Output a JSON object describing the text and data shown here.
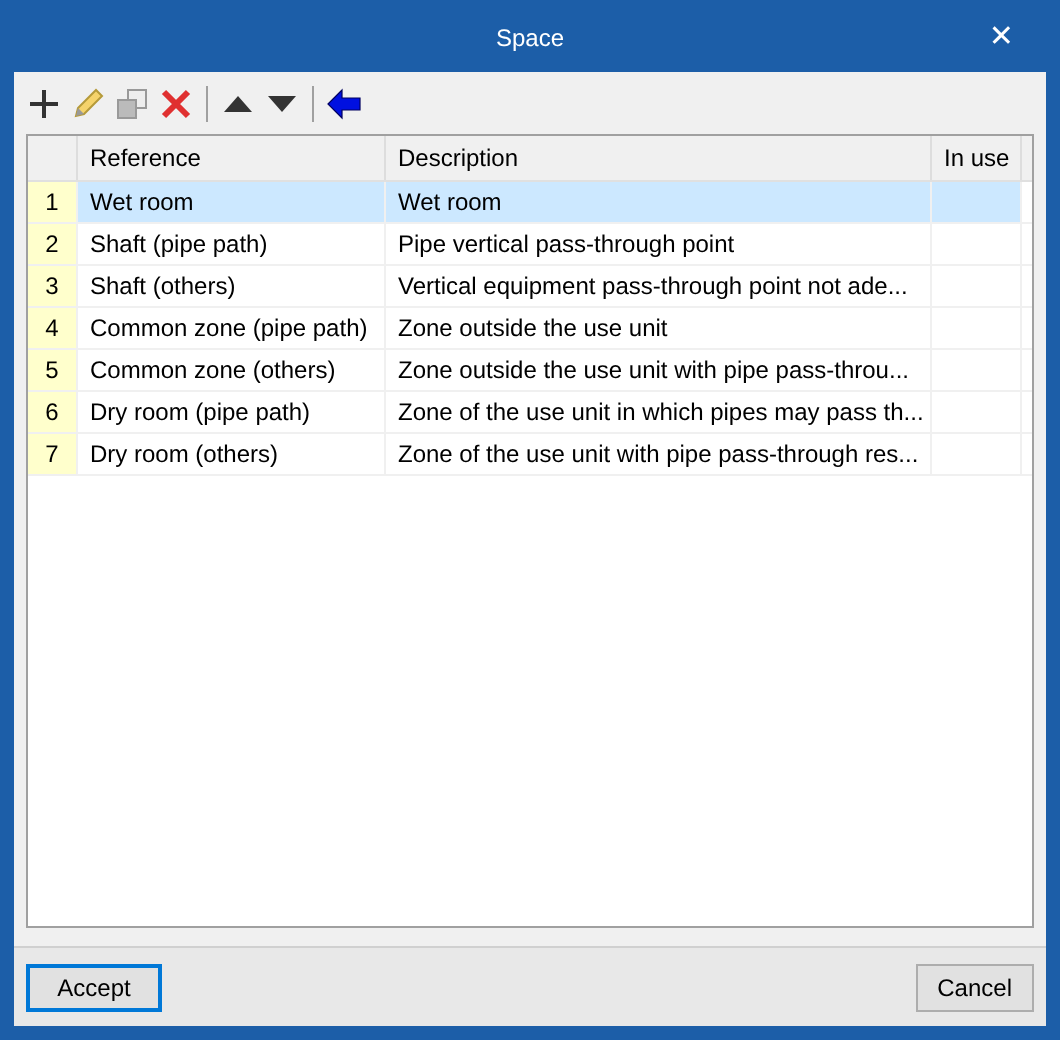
{
  "window": {
    "title": "Space",
    "close": "✕"
  },
  "toolbar": [
    {
      "kind": "add"
    },
    {
      "kind": "edit"
    },
    {
      "kind": "copy"
    },
    {
      "kind": "delete"
    },
    {
      "kind": "sep"
    },
    {
      "kind": "up"
    },
    {
      "kind": "down"
    },
    {
      "kind": "sep"
    },
    {
      "kind": "back"
    }
  ],
  "table": {
    "columns": [
      "Reference",
      "Description",
      "In use"
    ],
    "rows": [
      {
        "number": "1",
        "reference": "Wet room",
        "description": "Wet room",
        "selected": true
      },
      {
        "number": "2",
        "reference": "Shaft (pipe path)",
        "description": "Pipe vertical pass-through point",
        "selected": false
      },
      {
        "number": "3",
        "reference": "Shaft (others)",
        "description": "Vertical equipment pass-through point not ade...",
        "selected": false
      },
      {
        "number": "4",
        "reference": "Common zone (pipe path)",
        "description": "Zone outside the use unit",
        "selected": false
      },
      {
        "number": "5",
        "reference": "Common zone (others)",
        "description": "Zone outside the use unit with pipe pass-throu...",
        "selected": false
      },
      {
        "number": "6",
        "reference": "Dry room (pipe path)",
        "description": "Zone of the use unit in which pipes may pass th...",
        "selected": false
      },
      {
        "number": "7",
        "reference": "Dry room (others)",
        "description": "Zone of the use unit with pipe pass-through res...",
        "selected": false
      }
    ]
  },
  "buttons": [
    {
      "label": "Accept",
      "default": true
    },
    {
      "label": "Cancel",
      "default": false
    }
  ]
}
